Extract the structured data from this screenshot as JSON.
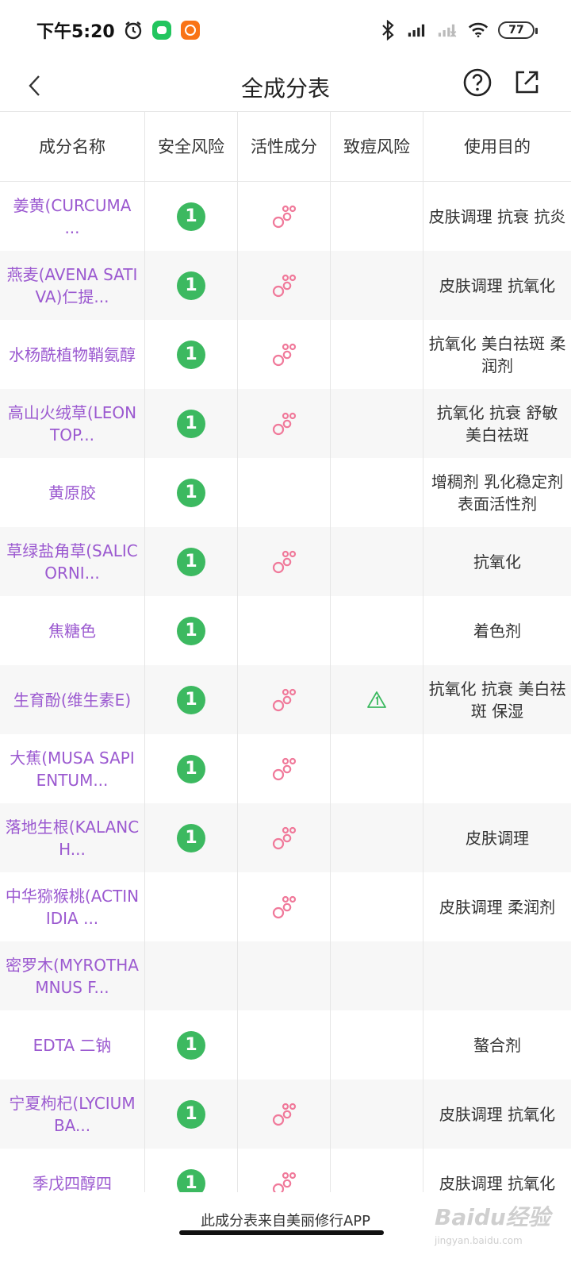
{
  "status_bar": {
    "time": "下午5:20",
    "battery": "77",
    "icons": [
      "alarm-icon",
      "app-green-icon",
      "app-orange-icon",
      "bluetooth-icon",
      "signal-icon",
      "signal-weak-icon",
      "wifi-icon",
      "battery-icon"
    ],
    "colors": {
      "green_app": "#22c55e",
      "orange_app": "#f97316"
    }
  },
  "nav": {
    "title": "全成分表",
    "icons": [
      "back-chevron-icon",
      "help-circle-icon",
      "share-icon"
    ]
  },
  "table": {
    "headers": [
      "成分名称",
      "安全风险",
      "活性成分",
      "致痘风险",
      "使用目的"
    ],
    "rows": [
      {
        "name": "姜黄(CURCUMA ...",
        "safety": "1",
        "active": true,
        "acne": false,
        "purpose": "皮肤调理 抗衰 抗炎"
      },
      {
        "name": "燕麦(AVENA SATIVA)仁提...",
        "safety": "1",
        "active": true,
        "acne": false,
        "purpose": "皮肤调理 抗氧化"
      },
      {
        "name": "水杨酰植物鞘氨醇",
        "safety": "1",
        "active": true,
        "acne": false,
        "purpose": "抗氧化 美白祛斑 柔润剂"
      },
      {
        "name": "高山火绒草(LEONTOP...",
        "safety": "1",
        "active": true,
        "acne": false,
        "purpose": "抗氧化 抗衰 舒敏 美白祛斑"
      },
      {
        "name": "黄原胶",
        "safety": "1",
        "active": false,
        "acne": false,
        "purpose": "增稠剂 乳化稳定剂 表面活性剂"
      },
      {
        "name": "草绿盐角草(SALICORNI...",
        "safety": "1",
        "active": true,
        "acne": false,
        "purpose": "抗氧化"
      },
      {
        "name": "焦糖色",
        "safety": "1",
        "active": false,
        "acne": false,
        "purpose": "着色剂"
      },
      {
        "name": "生育酚(维生素E)",
        "safety": "1",
        "active": true,
        "acne": true,
        "purpose": "抗氧化 抗衰 美白祛斑 保湿"
      },
      {
        "name": "大蕉(MUSA SAPIENTUM...",
        "safety": "1",
        "active": true,
        "acne": false,
        "purpose": ""
      },
      {
        "name": "落地生根(KALANCH...",
        "safety": "1",
        "active": true,
        "acne": false,
        "purpose": "皮肤调理"
      },
      {
        "name": "中华猕猴桃(ACTINIDIA ...",
        "safety": "",
        "active": true,
        "acne": false,
        "purpose": "皮肤调理 柔润剂"
      },
      {
        "name": "密罗木(MYROTHAMNUS F...",
        "safety": "",
        "active": false,
        "acne": false,
        "purpose": ""
      },
      {
        "name": "EDTA 二钠",
        "safety": "1",
        "active": false,
        "acne": false,
        "purpose": "螯合剂"
      },
      {
        "name": "宁夏枸杞(LYCIUM BA...",
        "safety": "1",
        "active": true,
        "acne": false,
        "purpose": "皮肤调理 抗氧化"
      },
      {
        "name": "季戊四醇四",
        "safety": "1",
        "active": true,
        "acne": false,
        "purpose": "皮肤调理 抗氧化"
      }
    ],
    "colors": {
      "name": "#9b59d0",
      "safety": "#3cb960",
      "active": "#f0799a",
      "acne": "#3cb960"
    }
  },
  "footer": {
    "text": "此成分表来自美丽修行APP",
    "watermark": "Baidu经验",
    "watermark_sub": "jingyan.baidu.com"
  }
}
